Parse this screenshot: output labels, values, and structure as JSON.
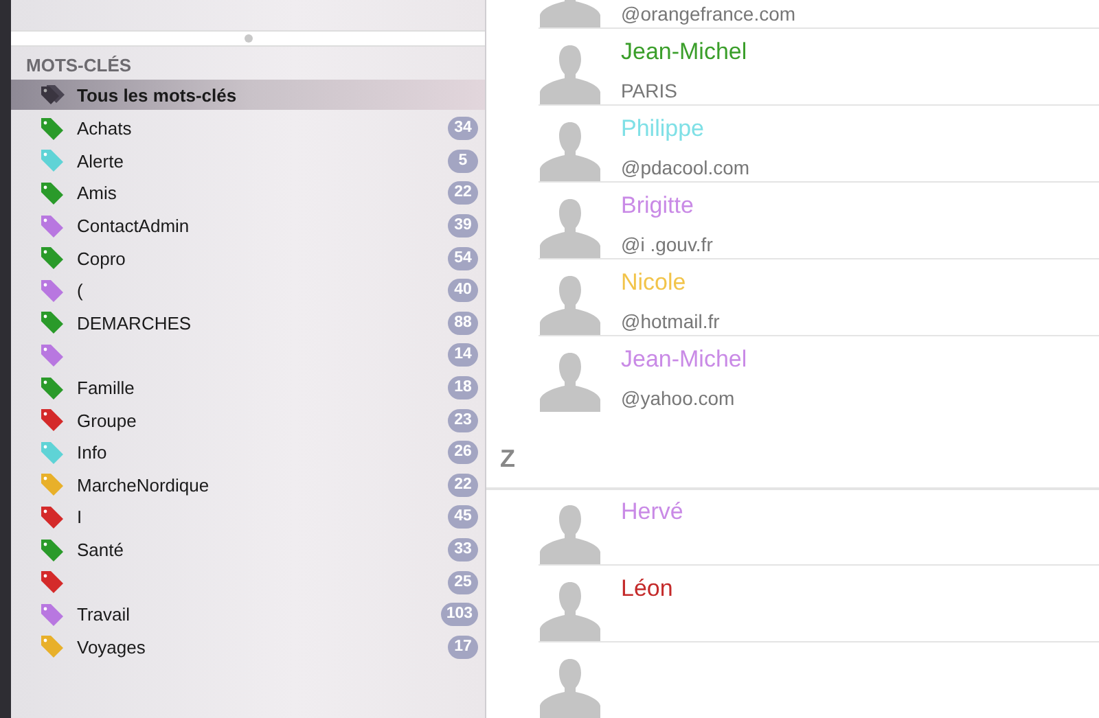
{
  "sidebar": {
    "header": "MOTS-CLÉS",
    "items": [
      {
        "label": "Tous les mots-clés",
        "kind": "all",
        "selected": true
      },
      {
        "label": "Achats",
        "count": "34",
        "color": "#2a9a2a",
        "selected": false
      },
      {
        "label": "Alerte",
        "count": "5",
        "color": "#5fd3d6",
        "selected": false
      },
      {
        "label": "Amis",
        "count": "22",
        "color": "#2a9a2a",
        "selected": false
      },
      {
        "label": "ContactAdmin",
        "count": "39",
        "color": "#b877e0",
        "selected": false
      },
      {
        "label": "Copro",
        "count": "54",
        "color": "#2a9a2a",
        "selected": false
      },
      {
        "label": "(",
        "count": "40",
        "color": "#b877e0",
        "selected": false
      },
      {
        "label": "DEMARCHES",
        "count": "88",
        "color": "#2a9a2a",
        "selected": false
      },
      {
        "count": "14",
        "color": "#b877e0",
        "selected": false
      },
      {
        "label": "Famille",
        "count": "18",
        "color": "#2a9a2a",
        "selected": false
      },
      {
        "label": "Groupe",
        "count": "23",
        "color": "#d42a2a",
        "selected": false
      },
      {
        "label": "Info",
        "count": "26",
        "color": "#5fd3d6",
        "selected": false
      },
      {
        "label": "MarcheNordique",
        "count": "22",
        "color": "#e8b02a",
        "selected": false
      },
      {
        "label": "I",
        "count": "45",
        "color": "#d42a2a",
        "selected": false
      },
      {
        "label": "Santé",
        "count": "33",
        "color": "#2a9a2a",
        "selected": false
      },
      {
        "count": "25",
        "color": "#d42a2a",
        "selected": false
      },
      {
        "label": "Travail",
        "count": "103",
        "color": "#b877e0",
        "selected": false
      },
      {
        "label": "Voyages",
        "count": "17",
        "color": "#e8b02a",
        "selected": false
      }
    ]
  },
  "contacts": [
    {
      "kind": "contact",
      "detail": "@orangefrance.com"
    },
    {
      "kind": "contact",
      "name": "Jean-Michel",
      "color": "#3a9e2a",
      "detail": "PARIS"
    },
    {
      "kind": "contact",
      "name": "Philippe",
      "color": "#7fe0e6",
      "detail": "@pdacool.com"
    },
    {
      "kind": "contact",
      "name": "Brigitte",
      "color": "#c98ae6",
      "detail": "@i .gouv.fr"
    },
    {
      "kind": "contact",
      "name": "Nicole",
      "color": "#f2c44a",
      "detail": "@hotmail.fr"
    },
    {
      "kind": "contact",
      "name": "Jean-Michel",
      "color": "#c98ae6",
      "detail": "@yahoo.com"
    },
    {
      "kind": "section",
      "letter": "Z"
    },
    {
      "kind": "contact",
      "name": "Hervé",
      "color": "#c98ae6"
    },
    {
      "kind": "contact",
      "name": "Léon",
      "color": "#c42a2a"
    },
    {
      "kind": "contact"
    }
  ]
}
